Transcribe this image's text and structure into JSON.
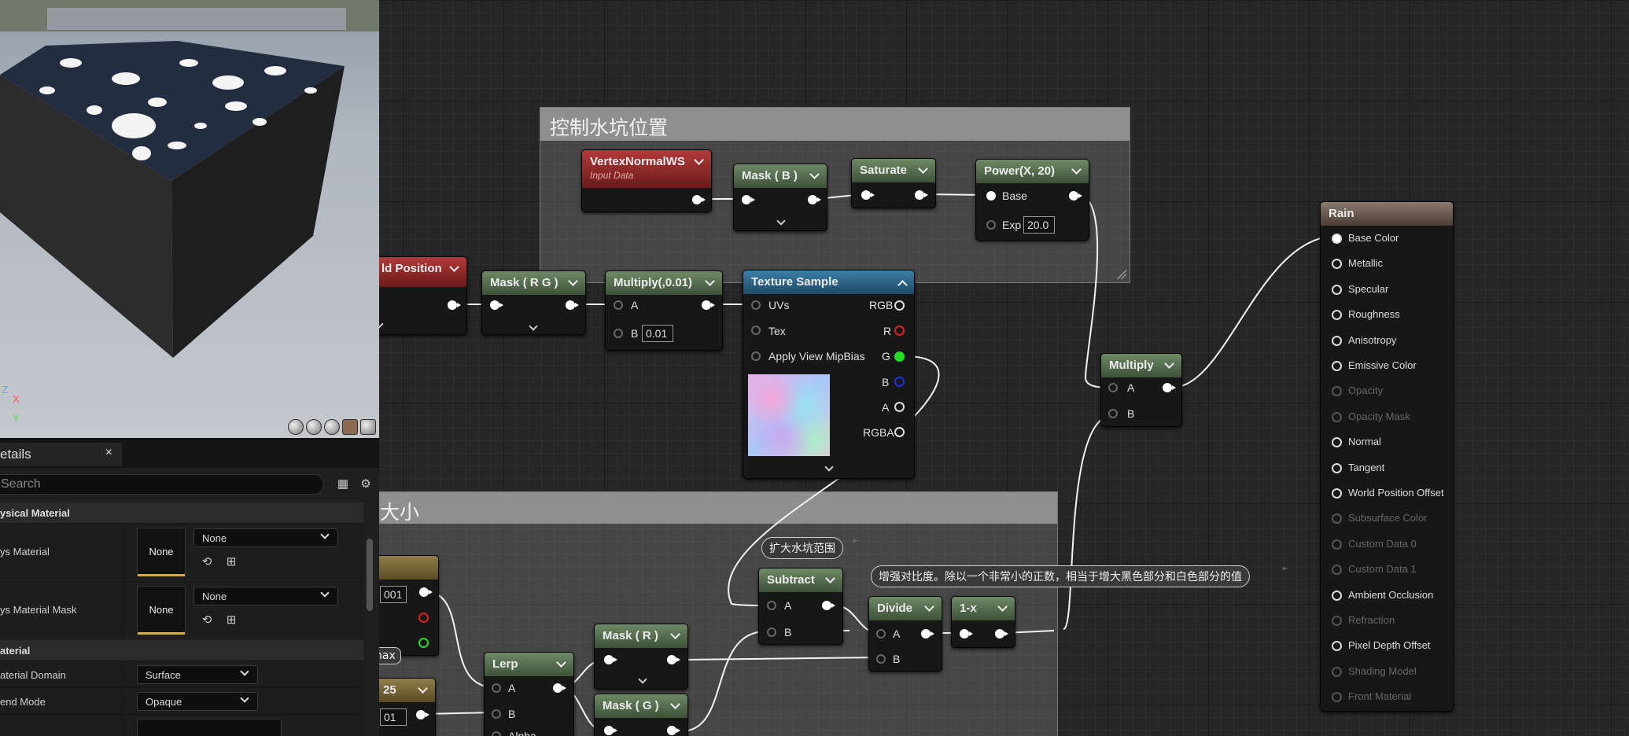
{
  "comments": {
    "puddle_position": "控制水坑位置",
    "puddle_size_partial": "大小"
  },
  "nodes": {
    "vertex_normal": {
      "title": "VertexNormalWS",
      "subtitle": "Input Data"
    },
    "mask_b": {
      "title": "Mask ( B )"
    },
    "saturate": {
      "title": "Saturate"
    },
    "power": {
      "title": "Power(X, 20)",
      "base": "Base",
      "exp": "Exp",
      "exp_value": "20.0"
    },
    "world_position": {
      "title": "ld Position"
    },
    "mask_rg": {
      "title": "Mask ( R G )"
    },
    "multiply_001": {
      "title": "Multiply(,0.01)",
      "a": "A",
      "b": "B",
      "b_value": "0.01"
    },
    "texture_sample": {
      "title": "Texture Sample",
      "uvs": "UVs",
      "tex": "Tex",
      "mip": "Apply View MipBias",
      "rgb": "RGB",
      "r": "R",
      "g": "G",
      "b": "B",
      "a": "A",
      "rgba": "RGBA"
    },
    "multiply": {
      "title": "Multiply",
      "a": "A",
      "b": "B"
    },
    "subtract": {
      "title": "Subtract",
      "a": "A",
      "b": "B"
    },
    "divide": {
      "title": "Divide",
      "a": "A",
      "b": "B"
    },
    "one_minus": {
      "title": "1-x"
    },
    "lerp": {
      "title": "Lerp",
      "a": "A",
      "b": "B",
      "alpha": "Alpha"
    },
    "mask_r": {
      "title": "Mask ( R )"
    },
    "mask_g": {
      "title": "Mask ( G )"
    },
    "param_left_1": {
      "value": "001"
    },
    "param_left_2": {
      "label": "nax"
    },
    "param_left_3": {
      "title": "25",
      "value": "01"
    }
  },
  "bubbles": {
    "expand_range": "扩大水坑范围",
    "contrast": "增强对比度。除以一个非常小的正数，相当于增大黑色部分和白色部分的值"
  },
  "rain": {
    "title": "Rain",
    "inputs": [
      {
        "label": "Base Color",
        "enabled": true
      },
      {
        "label": "Metallic",
        "enabled": true
      },
      {
        "label": "Specular",
        "enabled": true
      },
      {
        "label": "Roughness",
        "enabled": true
      },
      {
        "label": "Anisotropy",
        "enabled": true
      },
      {
        "label": "Emissive Color",
        "enabled": true
      },
      {
        "label": "Opacity",
        "enabled": false
      },
      {
        "label": "Opacity Mask",
        "enabled": false
      },
      {
        "label": "Normal",
        "enabled": true
      },
      {
        "label": "Tangent",
        "enabled": true
      },
      {
        "label": "World Position Offset",
        "enabled": true
      },
      {
        "label": "Subsurface Color",
        "enabled": false
      },
      {
        "label": "Custom Data 0",
        "enabled": false
      },
      {
        "label": "Custom Data 1",
        "enabled": false
      },
      {
        "label": "Ambient Occlusion",
        "enabled": true
      },
      {
        "label": "Refraction",
        "enabled": false
      },
      {
        "label": "Pixel Depth Offset",
        "enabled": true
      },
      {
        "label": "Shading Model",
        "enabled": false
      },
      {
        "label": "Front Material",
        "enabled": false
      }
    ]
  },
  "viewport": {
    "axis_z": "Z",
    "axis_x": "X",
    "axis_y": "Y"
  },
  "details": {
    "tab_label": "etails",
    "close": "×",
    "search_placeholder": "Search",
    "category_physical": "ysical Material",
    "phys_material_label": "ys Material",
    "phys_material_thumb": "None",
    "phys_material_combo": "None",
    "phys_mask_label": "ys Material Mask",
    "phys_mask_thumb": "None",
    "phys_mask_combo": "None",
    "category_material": "aterial",
    "domain_label": "aterial Domain",
    "domain_value": "Surface",
    "blend_label": "end Mode",
    "blend_value": "Opaque"
  },
  "colors": {
    "pin_red": "#e02020",
    "pin_green": "#22dd22",
    "pin_blue": "#2030e0",
    "accent_thumb": "#d6a95a"
  }
}
